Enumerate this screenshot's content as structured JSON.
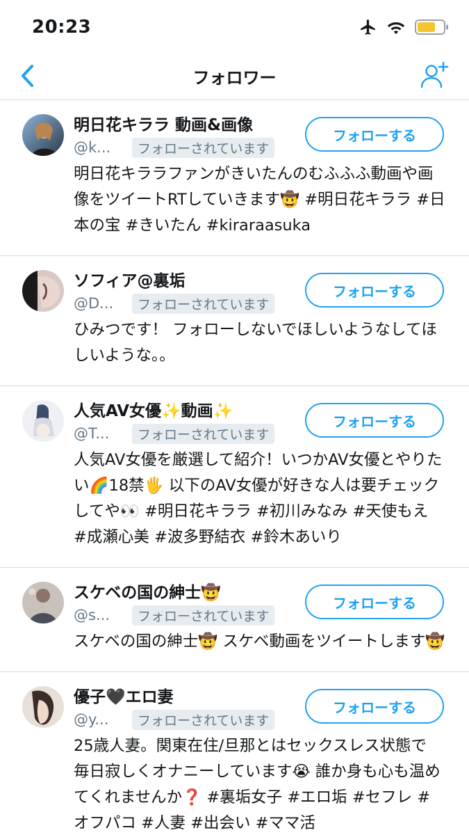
{
  "status_bar": {
    "time": "20:23"
  },
  "nav": {
    "title": "フォロワー"
  },
  "followers": [
    {
      "name": "明日花キララ 動画&画像",
      "handle": "@k...",
      "follows_badge": "フォローされています",
      "follow_label": "フォローする",
      "bio": "明日花キララファンがきいたんのむふふふ動画や画像をツイートRTしていきます🤠 #明日花キララ #日本の宝 #きいたん #kiraraasuka"
    },
    {
      "name": "ソフィア@裏垢",
      "handle": "@D...",
      "follows_badge": "フォローされています",
      "follow_label": "フォローする",
      "bio": "ひみつです！ フォローしないでほしいようなしてほしいような。。"
    },
    {
      "name": "人気AV女優✨動画✨",
      "handle": "@T...",
      "follows_badge": "フォローされています",
      "follow_label": "フォローする",
      "bio": "人気AV女優を厳選して紹介！いつかAV女優とやりたい🌈18禁🖐 以下のAV女優が好きな人は要チェックしてや👀 #明日花キララ #初川みなみ #天使もえ #成瀬心美 #波多野結衣 #鈴木あいり"
    },
    {
      "name": "スケベの国の紳士🤠",
      "handle": "@s...",
      "follows_badge": "フォローされています",
      "follow_label": "フォローする",
      "bio": "スケベの国の紳士🤠 スケベ動画をツイートします🤠"
    },
    {
      "name": "優子🖤エロ妻",
      "handle": "@y...",
      "follows_badge": "フォローされています",
      "follow_label": "フォローする",
      "bio": "25歳人妻。関東在住/旦那とはセックスレス状態で 毎日寂しくオナニーしています😭 誰か身も心も温めてくれませんか❓ #裏垢女子 #エロ垢 #セフレ #オフパコ #人妻 #出会い #ママ活"
    }
  ],
  "colors": {
    "accent": "#1da1f2",
    "secondary_text": "#657786",
    "badge_bg": "#e6ecf0",
    "divider": "#d6d9dc",
    "battery": "#f4c430"
  },
  "icons": {
    "back": "chevron-left-icon",
    "add_user": "add-user-icon",
    "airplane": "airplane-icon",
    "wifi": "wifi-icon",
    "battery": "battery-icon"
  }
}
